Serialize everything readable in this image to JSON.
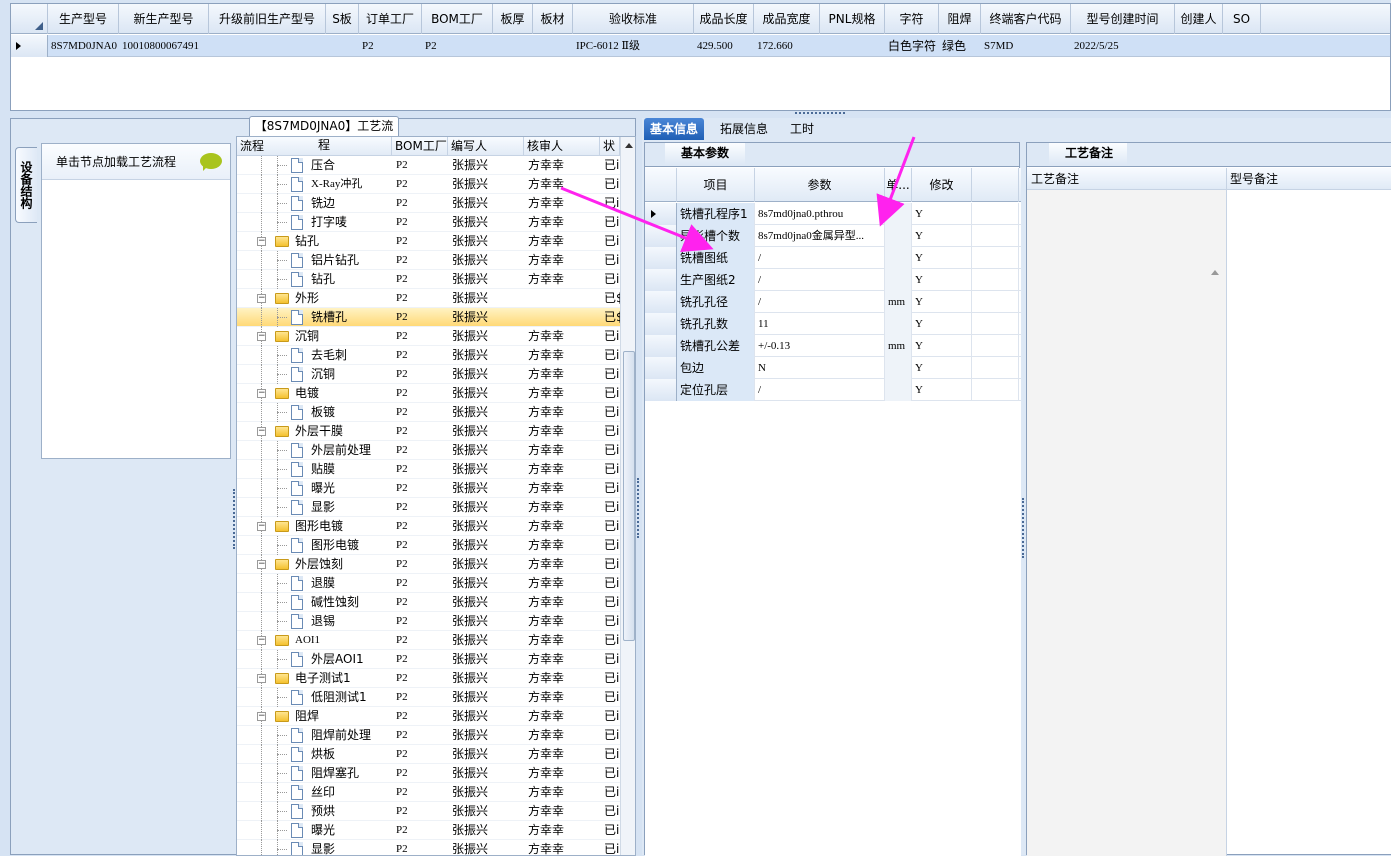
{
  "top_grid": {
    "headers": [
      "生产型号",
      "新生产型号",
      "升级前旧生产型号",
      "S板",
      "订单工厂",
      "BOM工厂",
      "板厚",
      "板材",
      "验收标准",
      "成品长度",
      "成品宽度",
      "PNL规格",
      "字符",
      "阻焊",
      "终端客户代码",
      "型号创建时间",
      "创建人",
      "SO"
    ],
    "row": {
      "model": "8S7MD0JNA0",
      "new_model": "10010800067491",
      "old_model": "",
      "s_board": "",
      "order_factory": "P2",
      "bom_factory": "P2",
      "thickness": "",
      "material": "",
      "standard": "IPC-6012 Ⅱ级",
      "length": "429.500",
      "width": "172.660",
      "pnl": "",
      "legend": "白色字符",
      "solder_mask": "绿色",
      "customer_code": "S7MD",
      "created": "2022/5/25",
      "creator": "",
      "so": ""
    }
  },
  "left": {
    "vertical_tab": "设备结构",
    "node_hint": "单击节点加载工艺流程",
    "tree_title": "【8S7MD0JNA0】工艺流程",
    "tree_headers": [
      "流程",
      "BOM工厂",
      "编写人",
      "核审人",
      "状"
    ],
    "rows": [
      {
        "label": "压合",
        "level": 2,
        "folder": false,
        "bom": "P2",
        "writer": "张振兴",
        "reviewer": "方幸幸",
        "status": "已i"
      },
      {
        "label": "X-Ray冲孔",
        "level": 2,
        "folder": false,
        "bom": "P2",
        "writer": "张振兴",
        "reviewer": "方幸幸",
        "status": "已i"
      },
      {
        "label": "铣边",
        "level": 2,
        "folder": false,
        "bom": "P2",
        "writer": "张振兴",
        "reviewer": "方幸幸",
        "status": "已i"
      },
      {
        "label": "打字唛",
        "level": 2,
        "folder": false,
        "bom": "P2",
        "writer": "张振兴",
        "reviewer": "方幸幸",
        "status": "已i"
      },
      {
        "label": "钻孔",
        "level": 1,
        "folder": true,
        "bom": "P2",
        "writer": "张振兴",
        "reviewer": "方幸幸",
        "status": "已i"
      },
      {
        "label": "铝片钻孔",
        "level": 2,
        "folder": false,
        "bom": "P2",
        "writer": "张振兴",
        "reviewer": "方幸幸",
        "status": "已i"
      },
      {
        "label": "钻孔",
        "level": 2,
        "folder": false,
        "bom": "P2",
        "writer": "张振兴",
        "reviewer": "方幸幸",
        "status": "已i"
      },
      {
        "label": "外形",
        "level": 1,
        "folder": true,
        "bom": "P2",
        "writer": "张振兴",
        "reviewer": "",
        "status": "已$"
      },
      {
        "label": "铣槽孔",
        "level": 2,
        "folder": false,
        "bom": "P2",
        "writer": "张振兴",
        "reviewer": "",
        "status": "已$",
        "selected": true
      },
      {
        "label": "沉铜",
        "level": 1,
        "folder": true,
        "bom": "P2",
        "writer": "张振兴",
        "reviewer": "方幸幸",
        "status": "已i"
      },
      {
        "label": "去毛刺",
        "level": 2,
        "folder": false,
        "bom": "P2",
        "writer": "张振兴",
        "reviewer": "方幸幸",
        "status": "已i"
      },
      {
        "label": "沉铜",
        "level": 2,
        "folder": false,
        "bom": "P2",
        "writer": "张振兴",
        "reviewer": "方幸幸",
        "status": "已i"
      },
      {
        "label": "电镀",
        "level": 1,
        "folder": true,
        "bom": "P2",
        "writer": "张振兴",
        "reviewer": "方幸幸",
        "status": "已i"
      },
      {
        "label": "板镀",
        "level": 2,
        "folder": false,
        "bom": "P2",
        "writer": "张振兴",
        "reviewer": "方幸幸",
        "status": "已i"
      },
      {
        "label": "外层干膜",
        "level": 1,
        "folder": true,
        "bom": "P2",
        "writer": "张振兴",
        "reviewer": "方幸幸",
        "status": "已i"
      },
      {
        "label": "外层前处理",
        "level": 2,
        "folder": false,
        "bom": "P2",
        "writer": "张振兴",
        "reviewer": "方幸幸",
        "status": "已i"
      },
      {
        "label": "贴膜",
        "level": 2,
        "folder": false,
        "bom": "P2",
        "writer": "张振兴",
        "reviewer": "方幸幸",
        "status": "已i"
      },
      {
        "label": "曝光",
        "level": 2,
        "folder": false,
        "bom": "P2",
        "writer": "张振兴",
        "reviewer": "方幸幸",
        "status": "已i"
      },
      {
        "label": "显影",
        "level": 2,
        "folder": false,
        "bom": "P2",
        "writer": "张振兴",
        "reviewer": "方幸幸",
        "status": "已i"
      },
      {
        "label": "图形电镀",
        "level": 1,
        "folder": true,
        "bom": "P2",
        "writer": "张振兴",
        "reviewer": "方幸幸",
        "status": "已i"
      },
      {
        "label": "图形电镀",
        "level": 2,
        "folder": false,
        "bom": "P2",
        "writer": "张振兴",
        "reviewer": "方幸幸",
        "status": "已i"
      },
      {
        "label": "外层蚀刻",
        "level": 1,
        "folder": true,
        "bom": "P2",
        "writer": "张振兴",
        "reviewer": "方幸幸",
        "status": "已i"
      },
      {
        "label": "退膜",
        "level": 2,
        "folder": false,
        "bom": "P2",
        "writer": "张振兴",
        "reviewer": "方幸幸",
        "status": "已i"
      },
      {
        "label": "碱性蚀刻",
        "level": 2,
        "folder": false,
        "bom": "P2",
        "writer": "张振兴",
        "reviewer": "方幸幸",
        "status": "已i"
      },
      {
        "label": "退锡",
        "level": 2,
        "folder": false,
        "bom": "P2",
        "writer": "张振兴",
        "reviewer": "方幸幸",
        "status": "已i"
      },
      {
        "label": "AOI1",
        "level": 1,
        "folder": true,
        "bom": "P2",
        "writer": "张振兴",
        "reviewer": "方幸幸",
        "status": "已i"
      },
      {
        "label": "外层AOI1",
        "level": 2,
        "folder": false,
        "bom": "P2",
        "writer": "张振兴",
        "reviewer": "方幸幸",
        "status": "已i"
      },
      {
        "label": "电子测试1",
        "level": 1,
        "folder": true,
        "bom": "P2",
        "writer": "张振兴",
        "reviewer": "方幸幸",
        "status": "已i"
      },
      {
        "label": "低阻测试1",
        "level": 2,
        "folder": false,
        "bom": "P2",
        "writer": "张振兴",
        "reviewer": "方幸幸",
        "status": "已i"
      },
      {
        "label": "阻焊",
        "level": 1,
        "folder": true,
        "bom": "P2",
        "writer": "张振兴",
        "reviewer": "方幸幸",
        "status": "已i"
      },
      {
        "label": "阻焊前处理",
        "level": 2,
        "folder": false,
        "bom": "P2",
        "writer": "张振兴",
        "reviewer": "方幸幸",
        "status": "已i"
      },
      {
        "label": "烘板",
        "level": 2,
        "folder": false,
        "bom": "P2",
        "writer": "张振兴",
        "reviewer": "方幸幸",
        "status": "已i"
      },
      {
        "label": "阻焊塞孔",
        "level": 2,
        "folder": false,
        "bom": "P2",
        "writer": "张振兴",
        "reviewer": "方幸幸",
        "status": "已i"
      },
      {
        "label": "丝印",
        "level": 2,
        "folder": false,
        "bom": "P2",
        "writer": "张振兴",
        "reviewer": "方幸幸",
        "status": "已i"
      },
      {
        "label": "预烘",
        "level": 2,
        "folder": false,
        "bom": "P2",
        "writer": "张振兴",
        "reviewer": "方幸幸",
        "status": "已i"
      },
      {
        "label": "曝光",
        "level": 2,
        "folder": false,
        "bom": "P2",
        "writer": "张振兴",
        "reviewer": "方幸幸",
        "status": "已i"
      },
      {
        "label": "显影",
        "level": 2,
        "folder": false,
        "bom": "P2",
        "writer": "张振兴",
        "reviewer": "方幸幸",
        "status": "已i"
      }
    ]
  },
  "right": {
    "tabs": [
      "基本信息",
      "拓展信息",
      "工时"
    ],
    "params_tab": "基本参数",
    "params_headers": [
      "项目",
      "参数",
      "单...",
      "修改"
    ],
    "params": [
      {
        "item": "铣槽孔程序1",
        "value": "8s7md0jna0.pthrou",
        "unit": "",
        "edit": "Y"
      },
      {
        "item": "异形槽个数",
        "value": "8s7md0jna0金属异型...",
        "unit": "",
        "edit": "Y"
      },
      {
        "item": "铣槽图纸",
        "value": "/",
        "unit": "",
        "edit": "Y"
      },
      {
        "item": "生产图纸2",
        "value": "/",
        "unit": "",
        "edit": "Y"
      },
      {
        "item": "铣孔孔径",
        "value": "/",
        "unit": "mm",
        "edit": "Y"
      },
      {
        "item": "铣孔孔数",
        "value": "11",
        "unit": "",
        "edit": "Y"
      },
      {
        "item": "铣槽孔公差",
        "value": "+/-0.13",
        "unit": "mm",
        "edit": "Y"
      },
      {
        "item": "包边",
        "value": "N",
        "unit": "",
        "edit": "Y"
      },
      {
        "item": "定位孔层",
        "value": "/",
        "unit": "",
        "edit": "Y"
      }
    ],
    "notes_tab": "工艺备注",
    "notes_headers": [
      "工艺备注",
      "型号备注"
    ]
  },
  "colors": {
    "arrow": "#ff22ee",
    "selection": "#ffd977",
    "active_tab": "#1f5fb5"
  }
}
